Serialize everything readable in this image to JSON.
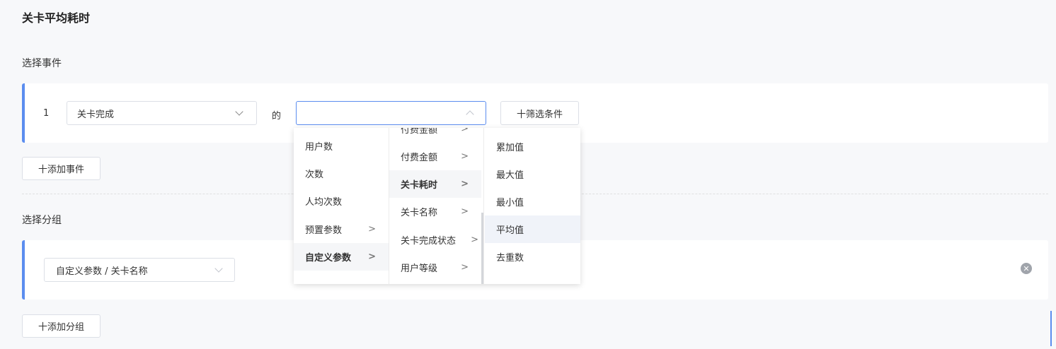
{
  "page_title": "关卡平均耗时",
  "section_event": {
    "title": "选择事件",
    "row_index": "1",
    "event_select": "关卡完成",
    "connector": "的",
    "metric_select": "",
    "filter_button": "十筛选条件",
    "add_event_button": "十添加事件"
  },
  "section_group": {
    "title": "选择分组",
    "group_select": "自定义参数 / 关卡名称",
    "add_group_button": "十添加分组"
  },
  "dropdown": {
    "col1": [
      {
        "label": "用户数",
        "arrow": ""
      },
      {
        "label": "次数",
        "arrow": ""
      },
      {
        "label": "人均次数",
        "arrow": ""
      },
      {
        "label": "预置参数",
        "arrow": ">"
      },
      {
        "label": "自定义参数",
        "arrow": ">"
      }
    ],
    "col2": [
      {
        "label": "付费金额",
        "arrow": ">"
      },
      {
        "label": "付费金额",
        "arrow": ">"
      },
      {
        "label": "关卡耗时",
        "arrow": ">"
      },
      {
        "label": "关卡名称",
        "arrow": ">"
      },
      {
        "label": "关卡完成状态",
        "arrow": ">"
      },
      {
        "label": "用户等级",
        "arrow": ">"
      }
    ],
    "col3": [
      {
        "label": "累加值"
      },
      {
        "label": "最大值"
      },
      {
        "label": "最小值"
      },
      {
        "label": "平均值"
      },
      {
        "label": "去重数"
      }
    ]
  },
  "colors": {
    "accent": "#5b8def",
    "background": "#f7f8fa"
  },
  "icons": {
    "remove_group": "close-circle-icon",
    "select_arrow": "chevron-down-icon",
    "select_arrow_open": "chevron-up-icon"
  }
}
